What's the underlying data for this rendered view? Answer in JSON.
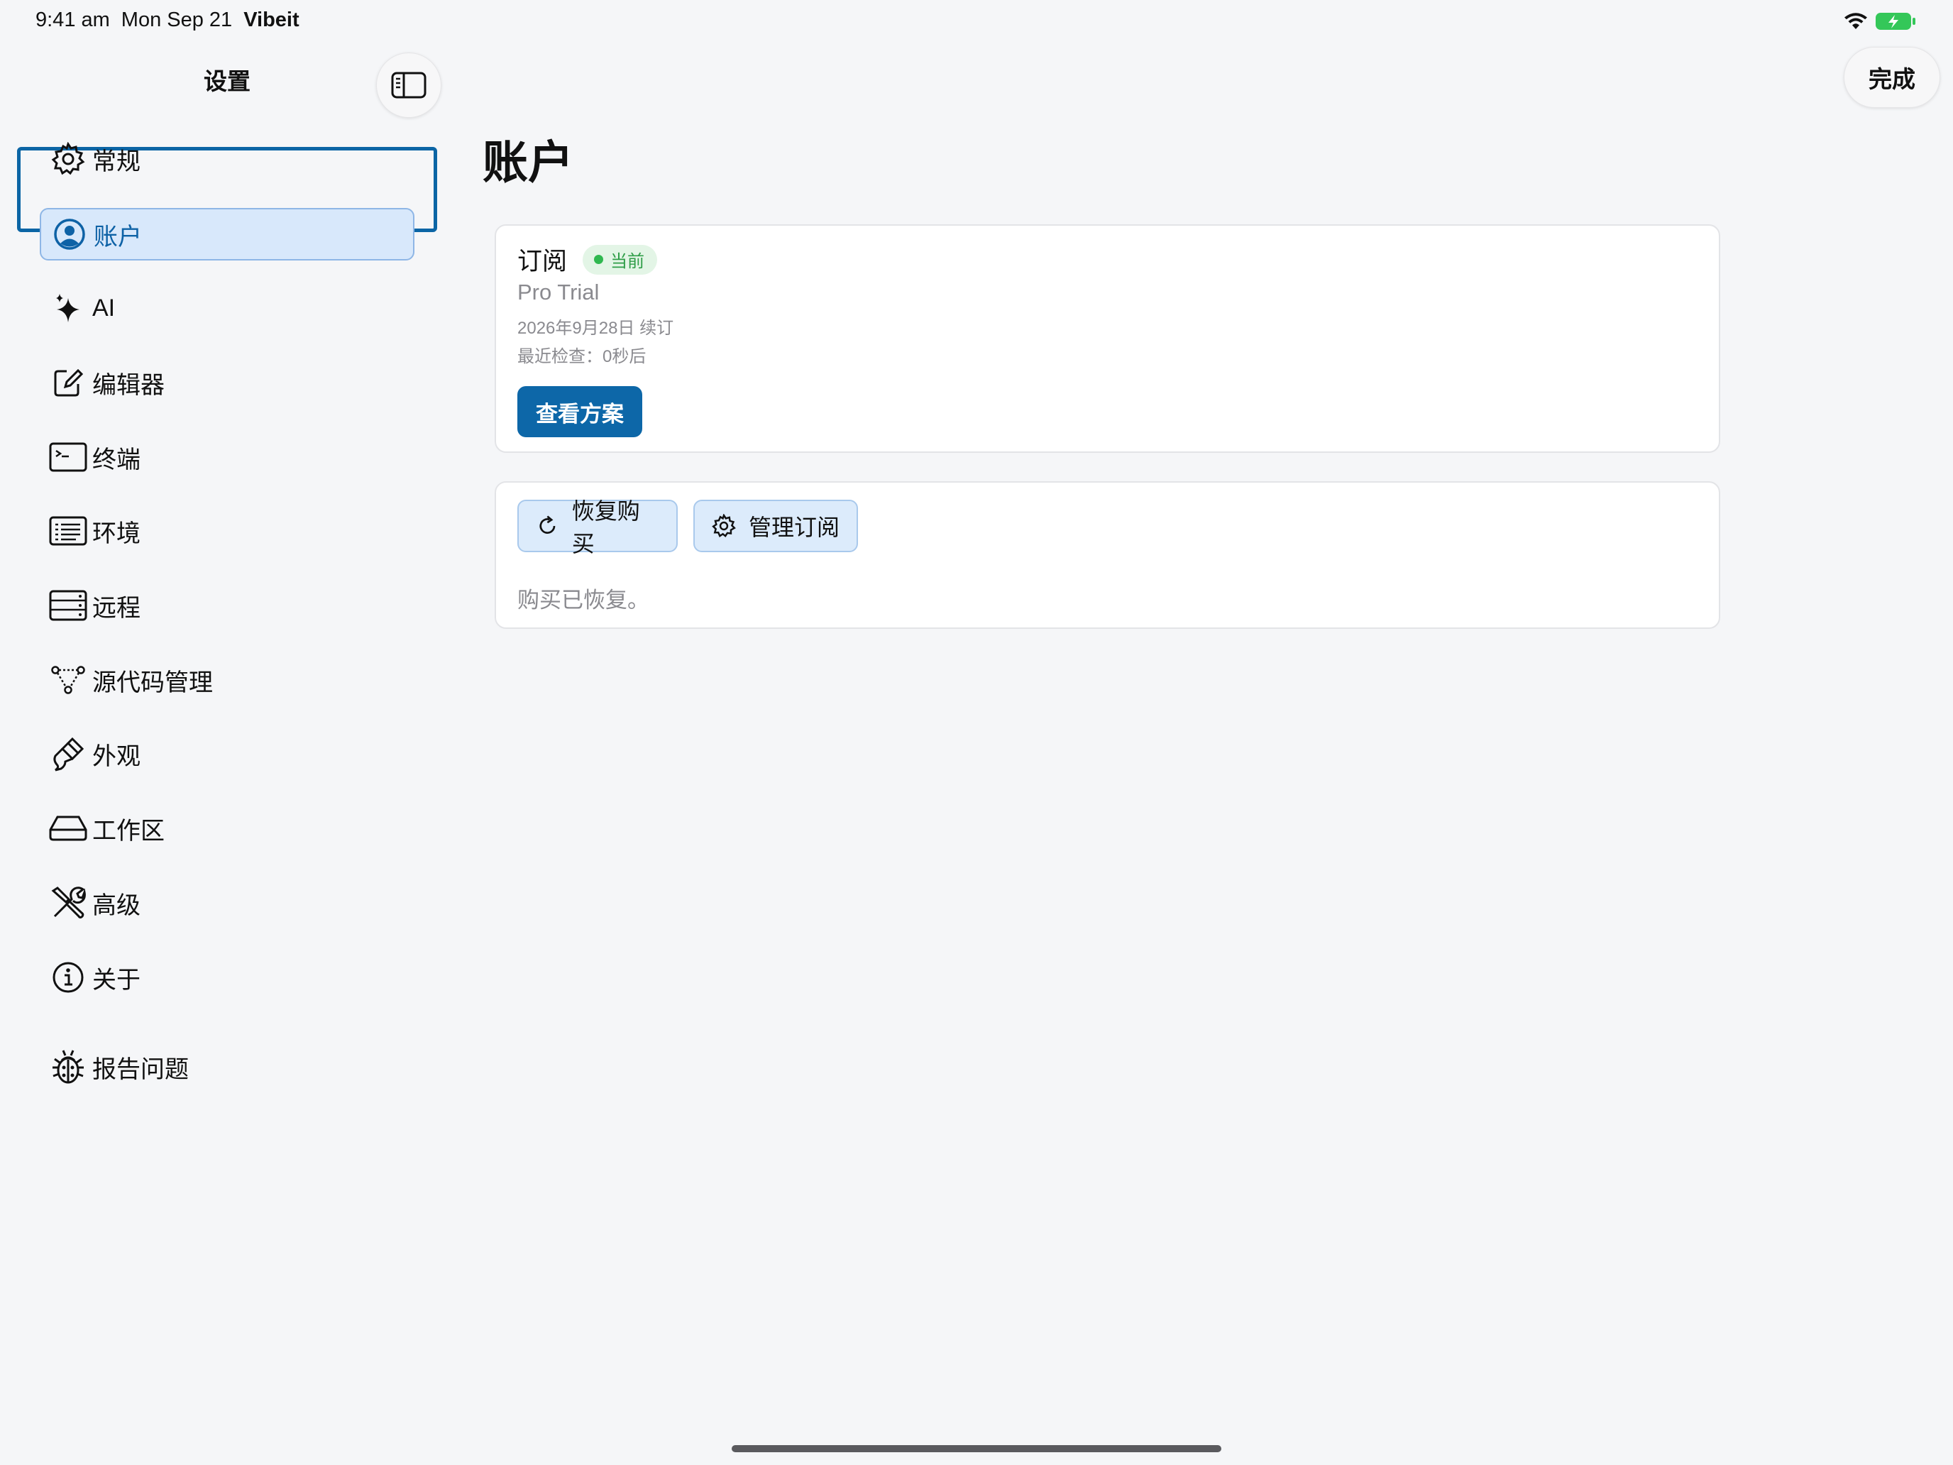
{
  "status_bar": {
    "time": "9:41 am",
    "date": "Mon Sep 21",
    "app": "Vibeit"
  },
  "sidebar": {
    "title": "设置",
    "items": [
      {
        "label": "常规",
        "icon": "gear-icon"
      },
      {
        "label": "账户",
        "icon": "person-circle-icon",
        "selected": true
      },
      {
        "label": "AI",
        "icon": "sparkles-icon"
      },
      {
        "label": "编辑器",
        "icon": "compose-icon"
      },
      {
        "label": "终端",
        "icon": "terminal-icon"
      },
      {
        "label": "环境",
        "icon": "list-icon"
      },
      {
        "label": "远程",
        "icon": "server-icon"
      },
      {
        "label": "源代码管理",
        "icon": "branch-icon"
      },
      {
        "label": "外观",
        "icon": "paintbrush-icon"
      },
      {
        "label": "工作区",
        "icon": "drive-icon"
      },
      {
        "label": "高级",
        "icon": "tools-icon"
      },
      {
        "label": "关于",
        "icon": "info-icon"
      },
      {
        "label": "报告问题",
        "icon": "bug-icon"
      }
    ]
  },
  "toolbar": {
    "done_label": "完成"
  },
  "main": {
    "title": "账户",
    "subscription": {
      "heading": "订阅",
      "badge": "当前",
      "plan": "Pro Trial",
      "renewal": "2026年9月28日 续订",
      "last_checked": "最近检查：0秒后",
      "view_plans_label": "查看方案"
    },
    "actions": {
      "restore_label": "恢复购买",
      "manage_label": "管理订阅",
      "status_message": "购买已恢复。"
    }
  },
  "colors": {
    "accent": "#0d67a8",
    "selected_bg": "#d8e8fb",
    "badge_green": "#2fb84f",
    "background": "#f5f6f8"
  }
}
